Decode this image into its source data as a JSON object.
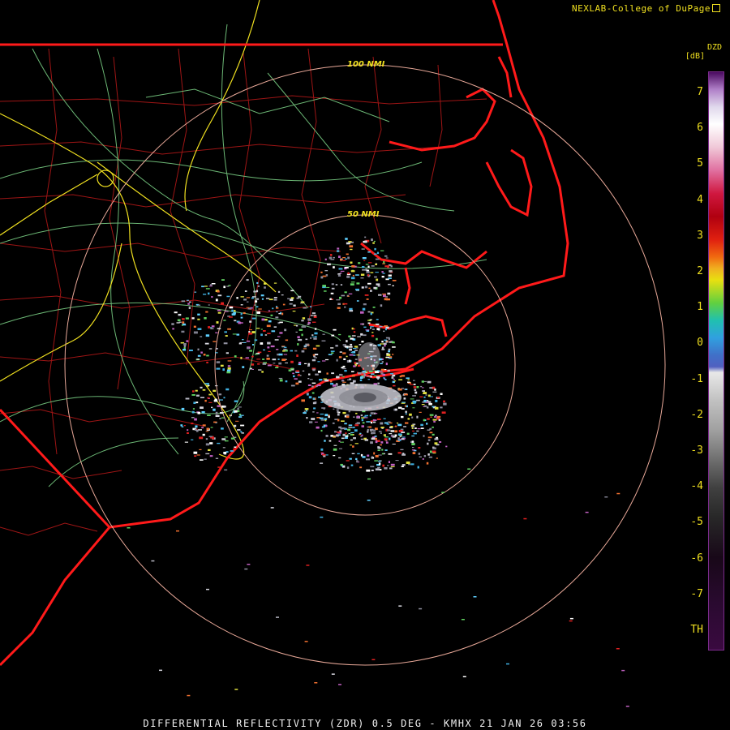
{
  "header": {
    "credit": "NEXLAB-College of DuPage"
  },
  "footer": {
    "caption": "DIFFERENTIAL REFLECTIVITY (ZDR) 0.5 DEG - KMHX 21 JAN 26 03:56"
  },
  "legend": {
    "product": "DZD",
    "unit": "[dB]",
    "ticks": [
      "7",
      "6",
      "5",
      "4",
      "3",
      "2",
      "1",
      "0",
      "-1",
      "-2",
      "-3",
      "-4",
      "-5",
      "-6",
      "-7",
      "TH"
    ]
  },
  "rings": {
    "inner": "50 NMI",
    "outer": "100 NMI"
  },
  "colors": {
    "coast": "#ff1a1a",
    "counties": "#b01818",
    "roads": "#7fd88a",
    "highways": "#f0e020",
    "rings": "#e8a898"
  }
}
